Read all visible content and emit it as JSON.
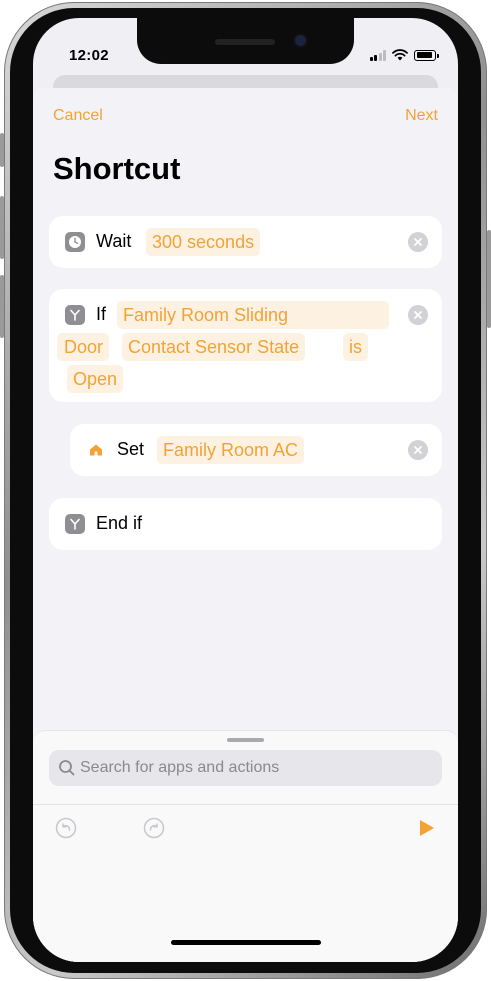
{
  "status_bar": {
    "time": "12:02"
  },
  "nav": {
    "cancel": "Cancel",
    "next": "Next"
  },
  "title": "Shortcut",
  "actions": {
    "wait": {
      "keyword": "Wait",
      "value": "300 seconds"
    },
    "if": {
      "keyword": "If",
      "subject_part1": "Family Room Sliding",
      "subject_part2": "Door",
      "property": "Contact Sensor State",
      "operator": "is",
      "value": "Open"
    },
    "set": {
      "keyword": "Set",
      "value": "Family Room AC"
    },
    "end_if": {
      "keyword": "End if"
    }
  },
  "search": {
    "placeholder": "Search for apps and actions"
  },
  "colors": {
    "accent": "#f3a236",
    "token_bg": "#fdf2e2",
    "background": "#f2f2f7",
    "icon_gray": "#8e8e93"
  },
  "icons": [
    "clock-icon",
    "if-branch-icon",
    "home-icon",
    "remove-icon",
    "search-icon",
    "undo-icon",
    "redo-icon",
    "play-icon"
  ]
}
